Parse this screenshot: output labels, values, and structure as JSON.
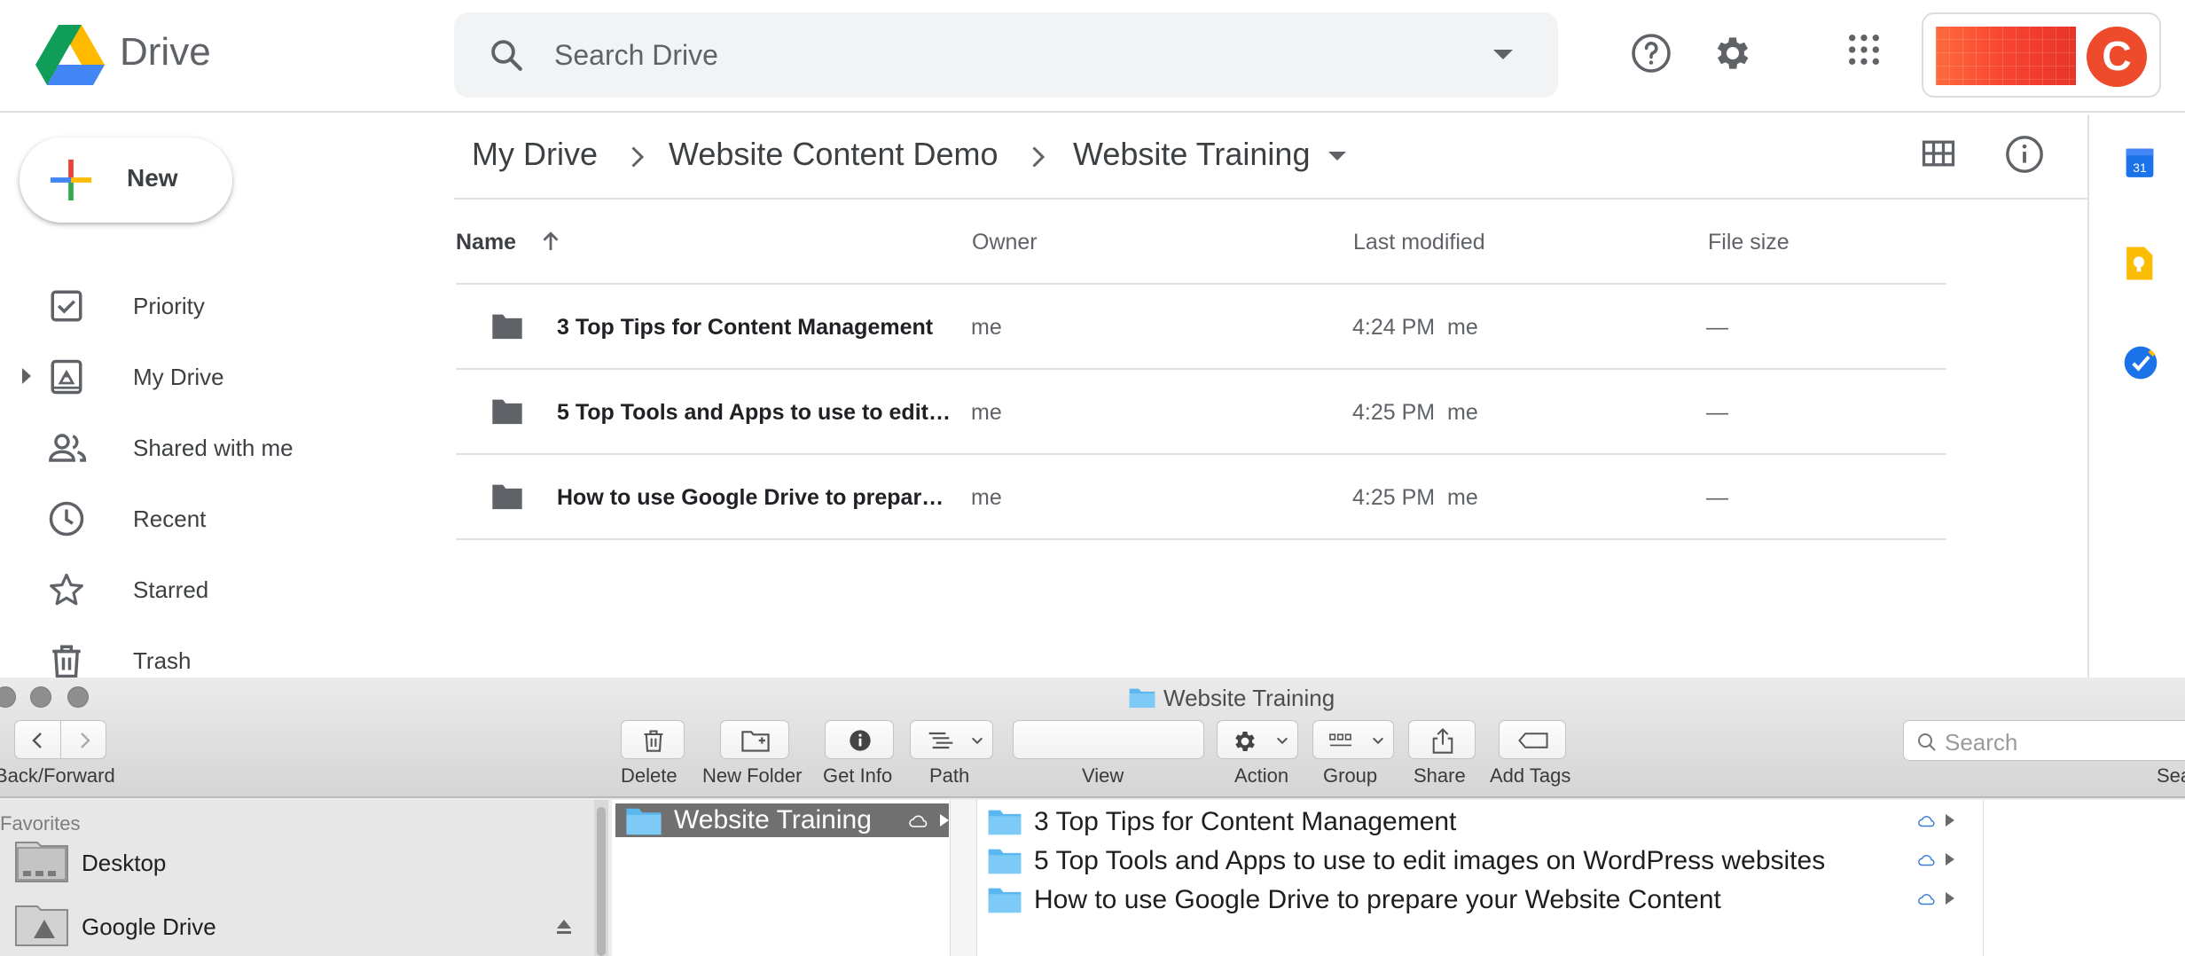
{
  "drive": {
    "app_name": "Drive",
    "search_placeholder": "Search Drive",
    "new_label": "New",
    "nav": [
      {
        "label": "Priority",
        "icon": "priority-icon"
      },
      {
        "label": "My Drive",
        "icon": "my-drive-icon"
      },
      {
        "label": "Shared with me",
        "icon": "shared-icon"
      },
      {
        "label": "Recent",
        "icon": "clock-icon"
      },
      {
        "label": "Starred",
        "icon": "star-icon"
      },
      {
        "label": "Trash",
        "icon": "trash-icon"
      }
    ],
    "breadcrumb": [
      "My Drive",
      "Website Content Demo",
      "Website Training"
    ],
    "columns": {
      "name": "Name",
      "owner": "Owner",
      "modified": "Last modified",
      "size": "File size"
    },
    "rows": [
      {
        "name": "3 Top Tips for Content Management",
        "owner": "me",
        "modified": "4:24 PM  me",
        "size": "—"
      },
      {
        "name": "5 Top Tools and Apps to use to edit…",
        "owner": "me",
        "modified": "4:25 PM  me",
        "size": "—"
      },
      {
        "name": "How to use Google Drive to prepar…",
        "owner": "me",
        "modified": "4:25 PM  me",
        "size": "—"
      }
    ],
    "calendar_date": "31",
    "account_letter": "C"
  },
  "finder": {
    "title": "Website Training",
    "toolbar": {
      "back_forward": "Back/Forward",
      "delete": "Delete",
      "new_folder": "New Folder",
      "get_info": "Get Info",
      "path": "Path",
      "view": "View",
      "action": "Action",
      "group": "Group",
      "share": "Share",
      "add_tags": "Add Tags",
      "search_placeholder": "Search",
      "search_label": "Sea"
    },
    "sidebar": {
      "heading": "Favorites",
      "items": [
        {
          "label": "Desktop",
          "icon": "desktop-icon"
        },
        {
          "label": "Google Drive",
          "icon": "google-drive-icon"
        }
      ]
    },
    "column1_selected": "Website Training",
    "column2_items": [
      "3 Top Tips for Content Management",
      "5 Top Tools and Apps to use to edit images on WordPress websites",
      "How to use Google Drive to prepare your Website Content"
    ]
  }
}
